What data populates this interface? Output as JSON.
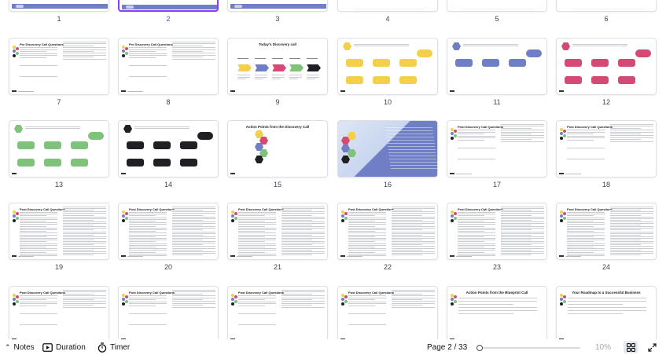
{
  "pages": [
    {
      "num": "1",
      "kind": "bluebar"
    },
    {
      "num": "2",
      "kind": "bluebar",
      "selected": true
    },
    {
      "num": "3",
      "kind": "bluebar"
    },
    {
      "num": "4",
      "kind": "blank"
    },
    {
      "num": "5",
      "kind": "blank"
    },
    {
      "num": "6",
      "kind": "blank"
    },
    {
      "num": "7",
      "kind": "questions",
      "title": "Pre Discovery Call Questions"
    },
    {
      "num": "8",
      "kind": "questions",
      "title": "Pre Discovery Call Questions"
    },
    {
      "num": "9",
      "kind": "arrows",
      "title": "Today's Discovery call"
    },
    {
      "num": "10",
      "kind": "flow",
      "color": "#f3cf4a",
      "accent": "#f3cf4a"
    },
    {
      "num": "11",
      "kind": "flow",
      "color": "#6f7fc6",
      "accent": "#6f7fc6"
    },
    {
      "num": "12",
      "kind": "flow",
      "color": "#d44a74",
      "accent": "#d44a74"
    },
    {
      "num": "13",
      "kind": "flow",
      "color": "#7fc27c",
      "accent": "#7fc27c"
    },
    {
      "num": "14",
      "kind": "flow",
      "color": "#1f1f24",
      "accent": "#1f1f24"
    },
    {
      "num": "15",
      "kind": "action",
      "title": "Action Points from the Discovery Call"
    },
    {
      "num": "16",
      "kind": "colorful"
    },
    {
      "num": "17",
      "kind": "questions",
      "title": "Post Discovery Call Questions"
    },
    {
      "num": "18",
      "kind": "questions",
      "title": "Post Discovery Call Questions"
    },
    {
      "num": "19",
      "kind": "dense",
      "title": "Post Discovery Call Questions"
    },
    {
      "num": "20",
      "kind": "dense",
      "title": "Post Discovery Call Questions"
    },
    {
      "num": "21",
      "kind": "dense",
      "title": "Post Discovery Call Questions"
    },
    {
      "num": "22",
      "kind": "dense",
      "title": "Post Discovery Call Questions"
    },
    {
      "num": "23",
      "kind": "dense",
      "title": "Post Discovery Call Questions"
    },
    {
      "num": "24",
      "kind": "dense",
      "title": "Post Discovery Call Questions"
    },
    {
      "num": "",
      "kind": "questions",
      "title": "Post Discovery Call Questions"
    },
    {
      "num": "",
      "kind": "questions",
      "title": "Post Discovery Call Questions"
    },
    {
      "num": "",
      "kind": "questions",
      "title": "Post Discovery Call Questions"
    },
    {
      "num": "",
      "kind": "questions",
      "title": "Post Discovery Call Questions"
    },
    {
      "num": "",
      "kind": "action",
      "title": "Action Points from the Blueprint Call"
    },
    {
      "num": "",
      "kind": "action",
      "title": "Your Roadmap to a Successful Business"
    }
  ],
  "toolbar": {
    "notes_label": "Notes",
    "duration_label": "Duration",
    "timer_label": "Timer",
    "page_indicator": "Page 2 / 33",
    "zoom_value": "10%"
  },
  "colors": {
    "accent_purple": "#8b3dff",
    "slide_blue": "#6f7fc6",
    "yellow": "#f3cf4a",
    "pink": "#d44a74",
    "green": "#7fc27c"
  }
}
